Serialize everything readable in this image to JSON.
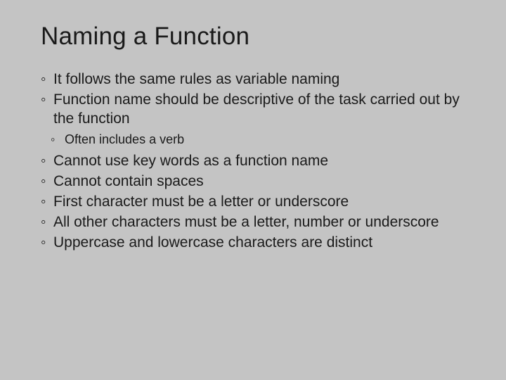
{
  "title": "Naming a Function",
  "bullets": {
    "b1": "It follows the same rules as variable naming",
    "b2": "Function name should be descriptive of the task carried out by the function",
    "b2_sub1": "Often includes a verb",
    "b3": "Cannot use key words as a function name",
    "b4": "Cannot contain spaces",
    "b5": "First character must be a letter or underscore",
    "b6": "All other characters must be a letter, number or underscore",
    "b7": "Uppercase and lowercase characters are distinct"
  }
}
